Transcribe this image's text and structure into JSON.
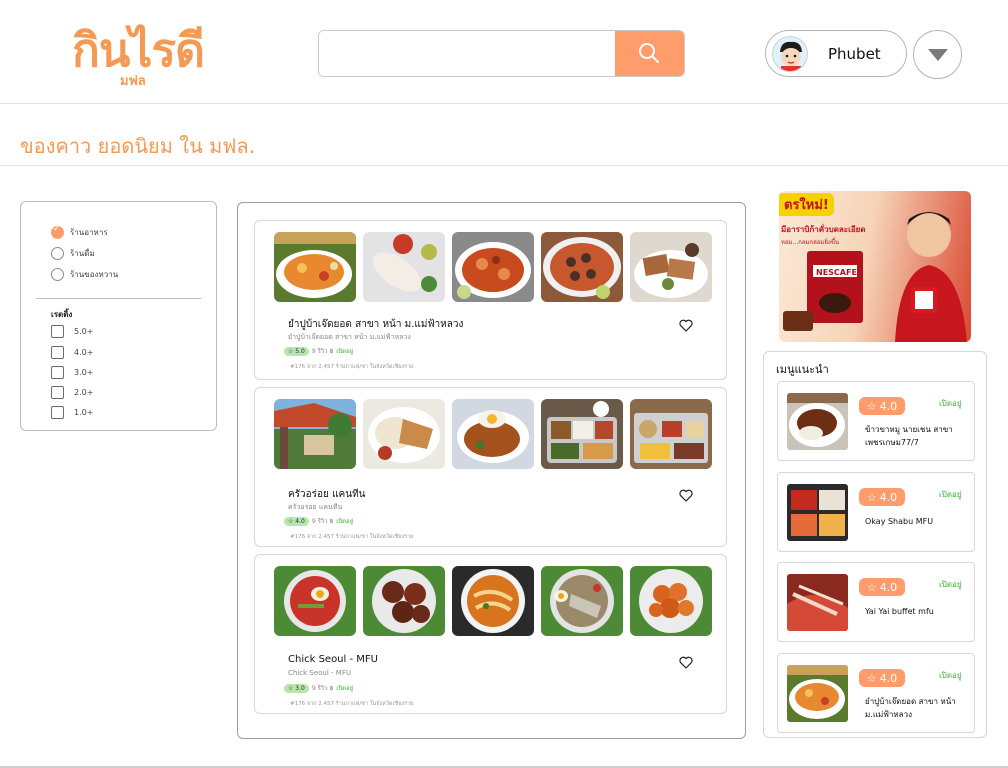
{
  "header": {
    "logo_main": "กินไรดี",
    "logo_sub": "มฟล",
    "search": {
      "placeholder": "",
      "value": ""
    },
    "user_name": "Phubet"
  },
  "page_title": "ของคาว ยอดนิยม ใน มฟล.",
  "filter": {
    "categories": [
      {
        "label": "ร้านอาหาร",
        "selected": true
      },
      {
        "label": "ร้านดื่ม",
        "selected": false
      },
      {
        "label": "ร้านของหวาน",
        "selected": false
      }
    ],
    "rating_heading": "เรตติ้ง",
    "ratings": [
      "5.0+",
      "4.0+",
      "3.0+",
      "2.0+",
      "1.0+"
    ]
  },
  "restaurants": [
    {
      "name": "ยำปูบ้าเจ๊ดยอด สาขา หน้า ม.แม่ฟ้าหลวง",
      "subtitle": "ยำปูบ้าเจ๊ดยอด สาขา หน้า ม.แม่ฟ้าหลวง",
      "rating": "5.0",
      "reviews": "9 รีวิว",
      "price": "฿",
      "status": "เปิดอยู่",
      "location": "#176 จาก 2,457 ร้านกาแฟ/ชา ในจังหวัดเชียงราย"
    },
    {
      "name": "ครัวอร่อย แคนทีน",
      "subtitle": "ครัวอร่อย แคนทีน",
      "rating": "4.0",
      "reviews": "9 รีวิว",
      "price": "฿",
      "status": "เปิดอยู่",
      "location": "#176 จาก 2,457 ร้านกาแฟ/ชา ในจังหวัดเชียงราย"
    },
    {
      "name": "Chick Seoul - MFU",
      "subtitle": "Chick Seoul - MFU",
      "rating": "3.0",
      "reviews": "9 รีวิว",
      "price": "฿",
      "status": "เปิดอยู่",
      "location": "#176 จาก 2,457 ร้านกาแฟ/ชา ในจังหวัดเชียงราย"
    }
  ],
  "ad": {
    "tag": "ตรใหม่!",
    "line1": "มีอาราบิก้าคั่วบดละเอียด",
    "line2": "หอม...กลมกล่อมยิ่งขึ้น",
    "brand": "NESCAFE"
  },
  "recommended": {
    "title": "เมนูแนะนำ",
    "items": [
      {
        "rating": "4.0",
        "status": "เปิดอยู่",
        "name": "ข้าวขาหมู นายเชน สาขาเพชรเกษม77/7"
      },
      {
        "rating": "4.0",
        "status": "เปิดอยู่",
        "name": "Okay Shabu MFU"
      },
      {
        "rating": "4.0",
        "status": "เปิดอยู่",
        "name": "Yai Yai buffet mfu"
      },
      {
        "rating": "4.0",
        "status": "เปิดอยู่",
        "name": "ยำปูบ้าเจ๊ดยอด สาขา หน้า ม.แม่ฟ้าหลวง"
      }
    ]
  },
  "colors": {
    "accent": "#fe9d6b",
    "logo": "#f49a54",
    "open_green": "#3eb23a",
    "rating_pill": "#b7e6a8"
  }
}
